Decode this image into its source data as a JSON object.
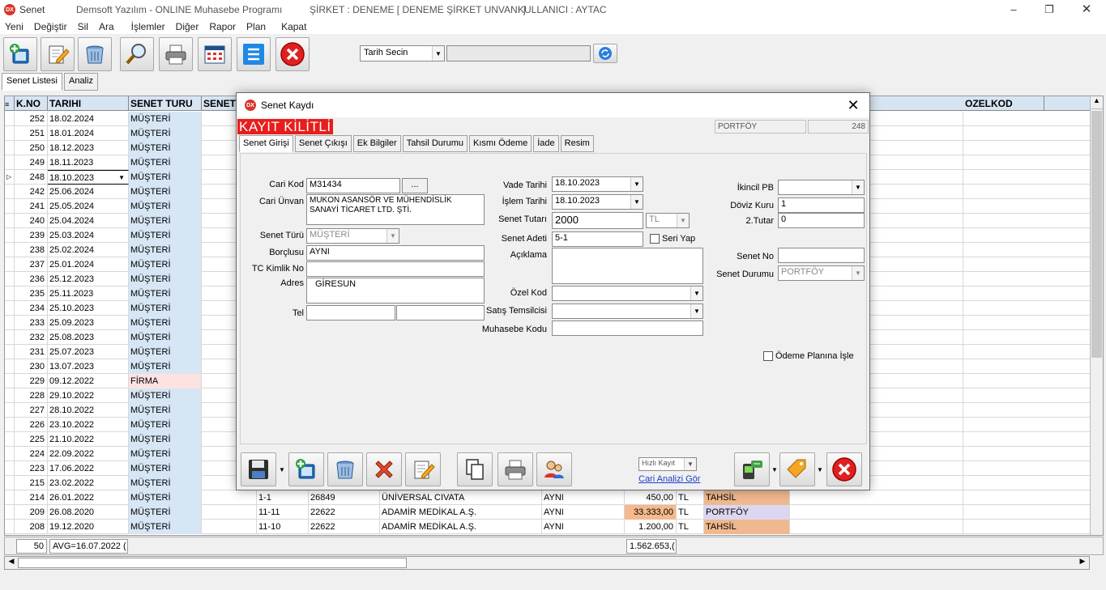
{
  "window": {
    "app_name": "Senet",
    "program": "Demsoft Yazılım - ONLINE Muhasebe Programı",
    "company": "ŞİRKET : DENEME [ DENEME ŞİRKET UNVANI ]",
    "user": "KULLANICI : AYTAC",
    "icon_text": "DX"
  },
  "menu": [
    "Yeni",
    "Değiştir",
    "Sil",
    "Ara",
    "İşlemler",
    "Diğer",
    "Rapor",
    "Plan",
    "Kapat"
  ],
  "toolbar": {
    "date_select": "Tarih Secin",
    "date_range": ""
  },
  "tabs": [
    "Senet Listesi",
    "Analiz"
  ],
  "grid": {
    "headers": [
      "K.NO",
      "TARIHI",
      "SENET TURU",
      "SENET",
      "OZELKOD"
    ],
    "rows": [
      {
        "no": "252",
        "date": "18.02.2024",
        "type": "MÜŞTERİ"
      },
      {
        "no": "251",
        "date": "18.01.2024",
        "type": "MÜŞTERİ"
      },
      {
        "no": "250",
        "date": "18.12.2023",
        "type": "MÜŞTERİ"
      },
      {
        "no": "249",
        "date": "18.11.2023",
        "type": "MÜŞTERİ"
      },
      {
        "no": "248",
        "date": "18.10.2023",
        "type": "MÜŞTERİ"
      },
      {
        "no": "242",
        "date": "25.06.2024",
        "type": "MÜŞTERİ"
      },
      {
        "no": "241",
        "date": "25.05.2024",
        "type": "MÜŞTERİ"
      },
      {
        "no": "240",
        "date": "25.04.2024",
        "type": "MÜŞTERİ"
      },
      {
        "no": "239",
        "date": "25.03.2024",
        "type": "MÜŞTERİ"
      },
      {
        "no": "238",
        "date": "25.02.2024",
        "type": "MÜŞTERİ"
      },
      {
        "no": "237",
        "date": "25.01.2024",
        "type": "MÜŞTERİ"
      },
      {
        "no": "236",
        "date": "25.12.2023",
        "type": "MÜŞTERİ"
      },
      {
        "no": "235",
        "date": "25.11.2023",
        "type": "MÜŞTERİ"
      },
      {
        "no": "234",
        "date": "25.10.2023",
        "type": "MÜŞTERİ"
      },
      {
        "no": "233",
        "date": "25.09.2023",
        "type": "MÜŞTERİ"
      },
      {
        "no": "232",
        "date": "25.08.2023",
        "type": "MÜŞTERİ"
      },
      {
        "no": "231",
        "date": "25.07.2023",
        "type": "MÜŞTERİ"
      },
      {
        "no": "230",
        "date": "13.07.2023",
        "type": "MÜŞTERİ"
      },
      {
        "no": "229",
        "date": "09.12.2022",
        "type": "FİRMA"
      },
      {
        "no": "228",
        "date": "29.10.2022",
        "type": "MÜŞTERİ"
      },
      {
        "no": "227",
        "date": "28.10.2022",
        "type": "MÜŞTERİ"
      },
      {
        "no": "226",
        "date": "23.10.2022",
        "type": "MÜŞTERİ"
      },
      {
        "no": "225",
        "date": "21.10.2022",
        "type": "MÜŞTERİ"
      },
      {
        "no": "224",
        "date": "22.09.2022",
        "type": "MÜŞTERİ"
      },
      {
        "no": "223",
        "date": "17.06.2022",
        "type": "MÜŞTERİ"
      },
      {
        "no": "215",
        "date": "23.02.2022",
        "type": "MÜŞTERİ"
      },
      {
        "no": "214",
        "date": "26.01.2022",
        "type": "MÜŞTERİ",
        "serial": "1-1",
        "cari": "26849",
        "name": "ÜNİVERSAL CIVATA",
        "borclu": "AYNI",
        "amount": "450,00",
        "cur": "TL",
        "status": "TAHSİL"
      },
      {
        "no": "209",
        "date": "26.08.2020",
        "type": "MÜŞTERİ",
        "serial": "11-11",
        "cari": "22622",
        "name": "ADAMİR MEDİKAL A.Ş.",
        "borclu": "AYNI",
        "amount": "33.333,00",
        "cur": "TL",
        "status": "PORTFÖY"
      },
      {
        "no": "208",
        "date": "19.12.2020",
        "type": "MÜŞTERİ",
        "serial": "11-10",
        "cari": "22622",
        "name": "ADAMİR MEDİKAL A.Ş.",
        "borclu": "AYNI",
        "amount": "1.200,00",
        "cur": "TL",
        "status": "TAHSİL"
      }
    ],
    "footer_count": "50",
    "footer_avg": "AVG=16.07.2022 (",
    "footer_total": "1.562.653,("
  },
  "dialog": {
    "title": "Senet Kaydı",
    "lock": "KAYIT KİLİTLİ",
    "status_top": "PORTFÖY",
    "record_no": "248",
    "tabs": [
      "Senet Girişi",
      "Senet Çıkışı",
      "Ek Bilgiler",
      "Tahsil Durumu",
      "Kısmı Ödeme",
      "İade",
      "Resim"
    ],
    "labels": {
      "cari_kod": "Cari Kod",
      "cari_unvan": "Cari Ünvan",
      "senet_turu": "Senet Türü",
      "borclusu": "Borçlusu",
      "tc": "TC Kimlik No",
      "adres": "Adres",
      "tel": "Tel",
      "vade": "Vade Tarihi",
      "islem": "İşlem Tarihi",
      "tutar": "Senet Tutarı",
      "adet": "Senet Adeti",
      "seri": "Seri Yap",
      "aciklama": "Açıklama",
      "ozel": "Özel Kod",
      "satis": "Satış Temsilcisi",
      "muh": "Muhasebe Kodu",
      "ikinci": "İkincil PB",
      "doviz": "Döviz Kuru",
      "tutar2": "2.Tutar",
      "senet_no": "Senet No",
      "senet_durum": "Senet Durumu",
      "odeme": "Ödeme Planına İşle",
      "hizli": "Hızlı Kayıt",
      "cari_analiz": "Cari Analizi Gör"
    },
    "values": {
      "cari_kod": "M31434",
      "browse": "...",
      "cari_unvan1": "MUKON ASANSÖR VE MÜHENDİSLİK",
      "cari_unvan2": "SANAYİ TİCARET LTD. ŞTİ.",
      "senet_turu": "MÜŞTERİ",
      "borclusu": "AYNI",
      "tc": "",
      "adres": "GİRESUN",
      "tel1": "",
      "tel2": "",
      "vade": "18.10.2023",
      "islem": "18.10.2023",
      "tutar": "2000",
      "currency": "TL",
      "adet": "5-1",
      "aciklama": "",
      "ozel": "",
      "satis": "",
      "muh": "",
      "ikinci": "",
      "doviz": "1",
      "tutar2": "0",
      "senet_no": "",
      "senet_durum": "PORTFÖY"
    }
  }
}
